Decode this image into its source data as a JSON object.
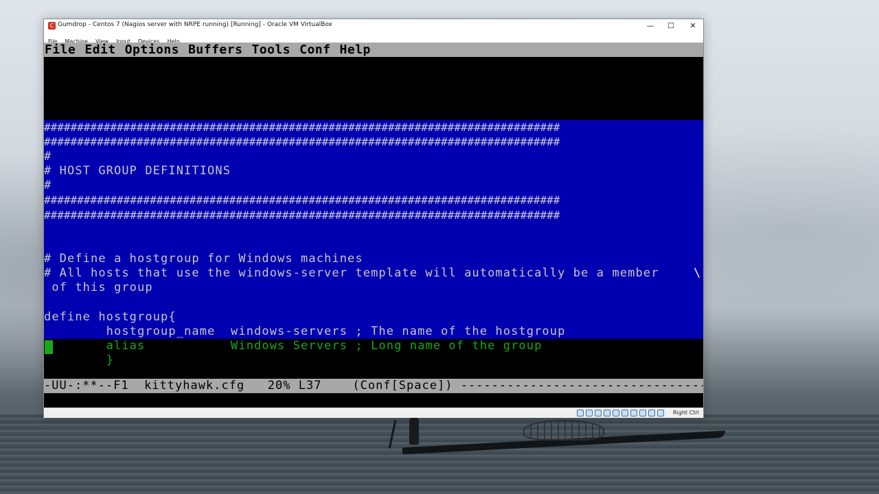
{
  "window": {
    "title": "Gumdrop - Centos 7 (Nagios server with NRPE running) [Running] - Oracle VM VirtualBox",
    "minimize": "—",
    "maximize": "☐",
    "close": "✕"
  },
  "vm_menu": [
    "File",
    "Machine",
    "View",
    "Input",
    "Devices",
    "Help"
  ],
  "emacs_menu": [
    "File",
    "Edit",
    "Options",
    "Buffers",
    "Tools",
    "Conf",
    "Help"
  ],
  "buffer": {
    "hash_line": "##############################################################################",
    "hash_line_short": "#",
    "section_title": "# HOST GROUP DEFINITIONS",
    "comment1": "# Define a hostgroup for Windows machines",
    "comment2": "# All hosts that use the windows-server template will automatically be a member",
    "wrap_mark": "\\",
    "comment2_cont": " of this group",
    "define_line": "define hostgroup{",
    "hostgroup_name_line": "        hostgroup_name  windows-servers ; The name of the hostgroup",
    "alias_line": "        alias           Windows Servers ; Long name of the group",
    "close_brace": "        }"
  },
  "modeline": {
    "text": "-UU-:**--F1  kittyhawk.cfg   20% L37    (Conf[Space]) -----------------------------------------------"
  },
  "statusbar": {
    "host_key": "Right Ctrl"
  }
}
